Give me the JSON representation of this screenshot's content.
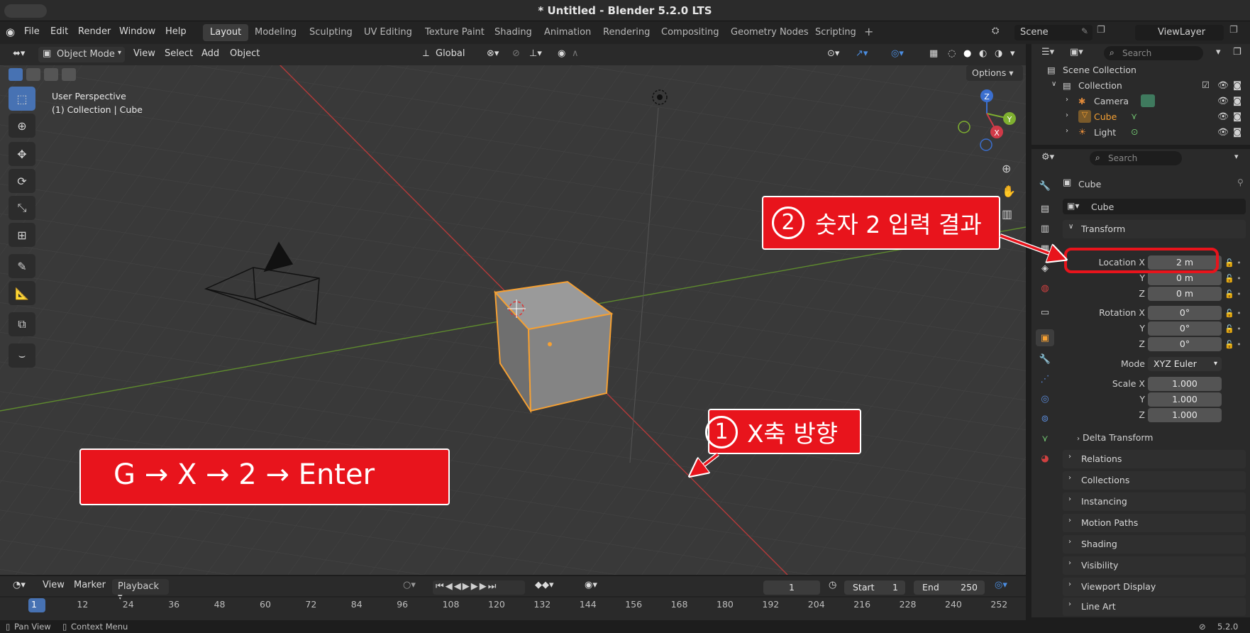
{
  "window": {
    "title": "* Untitled - Blender 5.2.0 LTS"
  },
  "menu": {
    "items": [
      "File",
      "Edit",
      "Render",
      "Window",
      "Help"
    ]
  },
  "workspaces": {
    "tabs": [
      "Layout",
      "Modeling",
      "Sculpting",
      "UV Editing",
      "Texture Paint",
      "Shading",
      "Animation",
      "Rendering",
      "Compositing",
      "Geometry Nodes",
      "Scripting"
    ],
    "active": "Layout",
    "add": "+"
  },
  "scene": {
    "name": "Scene",
    "view_layer": "ViewLayer"
  },
  "viewport_header": {
    "mode": "Object Mode",
    "view": "View",
    "select": "Select",
    "add": "Add",
    "object": "Object",
    "orientation": "Global",
    "options": "Options"
  },
  "viewport": {
    "perspective": "User Perspective",
    "collection_info": "(1) Collection | Cube",
    "gizmo_axes": {
      "x": "X",
      "y": "Y",
      "z": "Z"
    }
  },
  "outliner": {
    "search_placeholder": "Search",
    "rows": [
      {
        "label": "Scene Collection"
      },
      {
        "label": "Collection"
      },
      {
        "label": "Camera"
      },
      {
        "label": "Cube"
      },
      {
        "label": "Light"
      }
    ]
  },
  "properties": {
    "search_placeholder": "Search",
    "object_name": "Cube",
    "datablock_name": "Cube",
    "transform": {
      "header": "Transform",
      "location": {
        "label": "Location X",
        "x": "2 m",
        "y": "0 m",
        "z": "0 m"
      },
      "rotation": {
        "label": "Rotation X",
        "x": "0°",
        "y": "0°",
        "z": "0°"
      },
      "mode_label": "Mode",
      "mode_value": "XYZ Euler",
      "scale": {
        "label": "Scale X",
        "x": "1.000",
        "y": "1.000",
        "z": "1.000"
      },
      "axis_y": "Y",
      "axis_z": "Z",
      "delta": "Delta Transform"
    },
    "panels": [
      "Relations",
      "Collections",
      "Instancing",
      "Motion Paths",
      "Shading",
      "Visibility",
      "Viewport Display",
      "Line Art"
    ]
  },
  "timeline": {
    "view": "View",
    "marker": "Marker",
    "playback": "Playback",
    "current_frame": "1",
    "start_label": "Start",
    "start": "1",
    "end_label": "End",
    "end": "250",
    "ruler": [
      "1",
      "12",
      "24",
      "36",
      "48",
      "60",
      "72",
      "84",
      "96",
      "108",
      "120",
      "132",
      "144",
      "156",
      "168",
      "180",
      "192",
      "204",
      "216",
      "228",
      "240",
      "252"
    ]
  },
  "statusbar": {
    "left1": "Pan View",
    "left2": "Context Menu",
    "version": "5.2.0"
  },
  "annotations": {
    "keys": "G → X → 2 → Enter",
    "callout1": {
      "num": "1",
      "text": "X축 방향"
    },
    "callout2": {
      "num": "2",
      "text": "숫자 2 입력 결과"
    }
  },
  "colors": {
    "accent": "#4772b3",
    "callout": "#e8141c",
    "selection": "#f5a033",
    "x_axis": "#c8303a",
    "y_axis": "#6a9a2a"
  }
}
